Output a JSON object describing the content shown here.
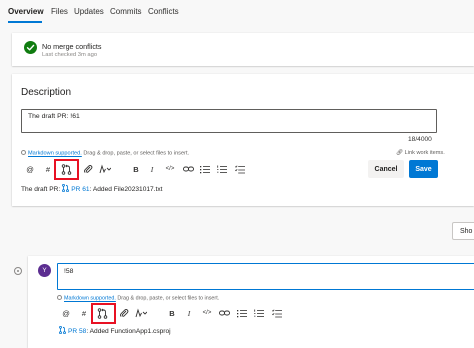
{
  "tabs": [
    {
      "label": "Overview",
      "active": true
    },
    {
      "label": "Files",
      "active": false
    },
    {
      "label": "Updates",
      "active": false
    },
    {
      "label": "Commits",
      "active": false
    },
    {
      "label": "Conflicts",
      "active": false
    }
  ],
  "merge_status": {
    "title": "No merge conflicts",
    "subtitle": "Last checked 3m ago"
  },
  "description": {
    "heading": "Description",
    "text": "The draft PR: !61",
    "counter": "18/4000",
    "markdown_link": "Markdown supported.",
    "markdown_rest": " Drag & drop, paste, or select files to insert.",
    "work_items_link": "Link work items.",
    "cancel_label": "Cancel",
    "save_label": "Save",
    "preview_prefix": "The draft PR:",
    "preview_pr_link": "PR 61",
    "preview_pr_title": ": Added File20231017.txt"
  },
  "toolbar_icons": [
    "mention-icon",
    "hashtag-icon",
    "pull-request-icon",
    "attach-icon",
    "highlight-icon",
    "bold-icon",
    "italic-icon",
    "code-icon",
    "link-icon",
    "bulleted-list-icon",
    "numbered-list-icon",
    "checklist-icon"
  ],
  "toolbar_glyphs": {
    "mention": "@",
    "hashtag": "#",
    "bold": "B",
    "italic": "I",
    "code": "</>"
  },
  "show_button_label": "Sho",
  "comment": {
    "avatar_initial": "Y",
    "text": "!58",
    "markdown_link": "Markdown supported.",
    "markdown_rest": " Drag & drop, paste, or select files to insert.",
    "preview_pr_link": "PR 58",
    "preview_pr_title": ": Added FunctionApp1.csproj"
  },
  "colors": {
    "accent": "#0078d4",
    "success": "#107c10",
    "highlight_box": "#e81123",
    "avatar": "#5c2e91"
  }
}
